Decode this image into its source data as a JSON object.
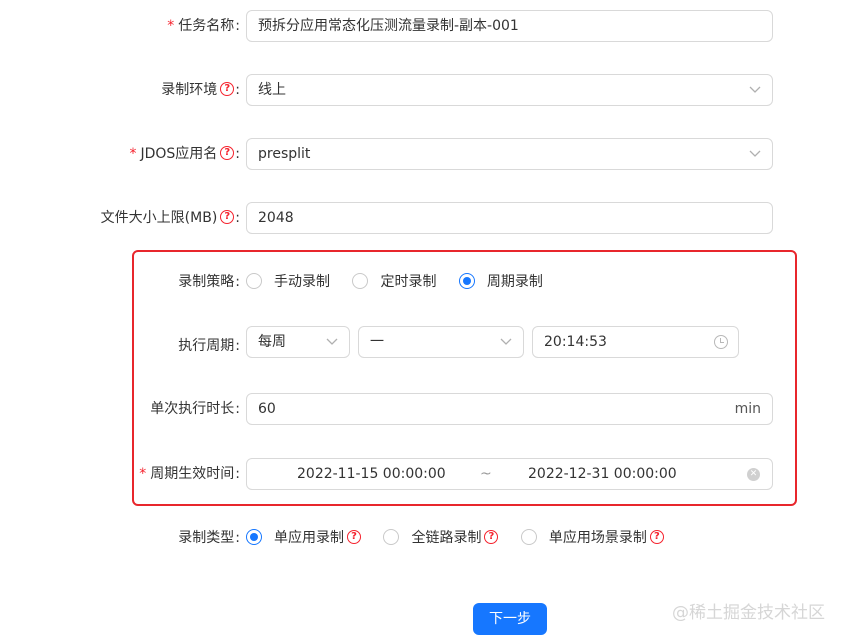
{
  "task_name": {
    "label": "任务名称",
    "value": "预拆分应用常态化压测流量录制-副本-001",
    "required": true
  },
  "env": {
    "label": "录制环境",
    "value": "线上"
  },
  "jdos_app": {
    "label": "JDOS应用名",
    "value": "presplit",
    "required": true
  },
  "file_limit": {
    "label": "文件大小上限(MB)",
    "value": "2048"
  },
  "strategy": {
    "label": "录制策略",
    "options": [
      "手动录制",
      "定时录制",
      "周期录制"
    ],
    "selected": "周期录制"
  },
  "period": {
    "label": "执行周期",
    "frequency": "每周",
    "day": "一",
    "time": "20:14:53"
  },
  "duration": {
    "label": "单次执行时长",
    "value": "60",
    "unit": "min"
  },
  "effective": {
    "label": "周期生效时间",
    "required": true,
    "start": "2022-11-15 00:00:00",
    "separator": "~",
    "end": "2022-12-31 00:00:00"
  },
  "record_type": {
    "label": "录制类型",
    "options": [
      "单应用录制",
      "全链路录制",
      "单应用场景录制"
    ],
    "selected": "单应用录制"
  },
  "next_button": "下一步",
  "watermark": "@稀土掘金技术社区",
  "colors": {
    "primary": "#1677ff",
    "required": "#f5222d",
    "highlight_box": "#e8262c"
  }
}
